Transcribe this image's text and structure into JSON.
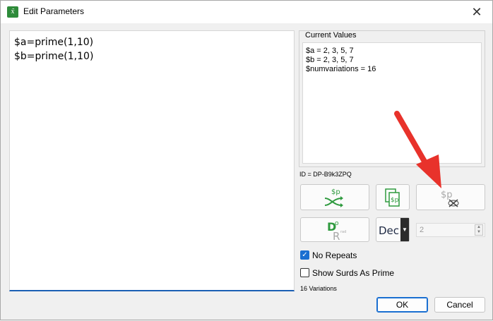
{
  "window": {
    "title": "Edit Parameters"
  },
  "editor": {
    "lines": [
      "$a=prime(1,10)",
      "$b=prime(1,10)"
    ]
  },
  "current_values": {
    "label": "Current Values",
    "lines": [
      "$a = 2, 3, 5, 7",
      "$b = 2, 3, 5, 7",
      "$numvariations = 16"
    ]
  },
  "id_text": "ID = DP-B9k3ZPQ",
  "buttons": {
    "shuffle_symbol": "$p",
    "copy_symbol": "$p",
    "clear_symbol": "$p",
    "deg_rad": {
      "d": "D",
      "r": "R",
      "deg": "o",
      "rad": "rad"
    }
  },
  "format_select": {
    "value": "Dec"
  },
  "decimal_places": {
    "value": "2"
  },
  "options": {
    "no_repeats": {
      "label": "No Repeats",
      "checked": true
    },
    "show_surds": {
      "label": "Show Surds As Prime",
      "checked": false
    }
  },
  "variations_text": "16 Variations",
  "dialog": {
    "ok_label": "OK",
    "cancel_label": "Cancel"
  },
  "colors": {
    "accent": "#1a6fd1",
    "icon_green": "#2e9a3e",
    "arrow_red": "#e8322b"
  },
  "icons": [
    "app-icon",
    "close-icon",
    "shuffle-icon",
    "copy-icon",
    "clear-icon",
    "degrees-radians-icon",
    "annotation-arrow"
  ]
}
